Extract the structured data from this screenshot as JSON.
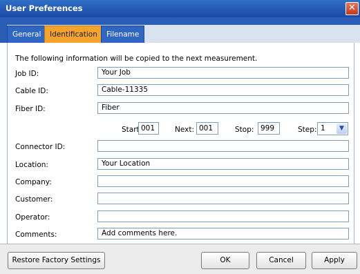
{
  "window": {
    "title": "User Preferences",
    "close_glyph": "✕"
  },
  "tabs": [
    {
      "label": "General",
      "active": false
    },
    {
      "label": "Identification",
      "active": true
    },
    {
      "label": "Filename",
      "active": false
    }
  ],
  "intro": "The following information will be copied to the next measurement.",
  "fields": {
    "job_id": {
      "label": "Job ID:",
      "value": "Your Job"
    },
    "cable_id": {
      "label": "Cable ID:",
      "value": "Cable-11335"
    },
    "fiber_id": {
      "label": "Fiber ID:",
      "value": "Fiber"
    },
    "connector_id": {
      "label": "Connector ID:",
      "value": ""
    },
    "location": {
      "label": "Location:",
      "value": "Your Location"
    },
    "company": {
      "label": "Company:",
      "value": ""
    },
    "customer": {
      "label": "Customer:",
      "value": ""
    },
    "operator": {
      "label": "Operator:",
      "value": ""
    },
    "comments": {
      "label": "Comments:",
      "value": "Add comments here."
    }
  },
  "sequence": {
    "start_label": "Start:",
    "start_value": "001",
    "next_label": "Next:",
    "next_value": "001",
    "stop_label": "Stop:",
    "stop_value": "999",
    "step_label": "Step:",
    "step_value": "1"
  },
  "buttons": {
    "restore": "Restore Factory Settings",
    "ok": "OK",
    "cancel": "Cancel",
    "apply": "Apply"
  },
  "colors": {
    "titlebar": "#1f55b0",
    "active_tab": "#f4a42a",
    "tab": "#2f66c4",
    "close": "#d04a2e"
  }
}
